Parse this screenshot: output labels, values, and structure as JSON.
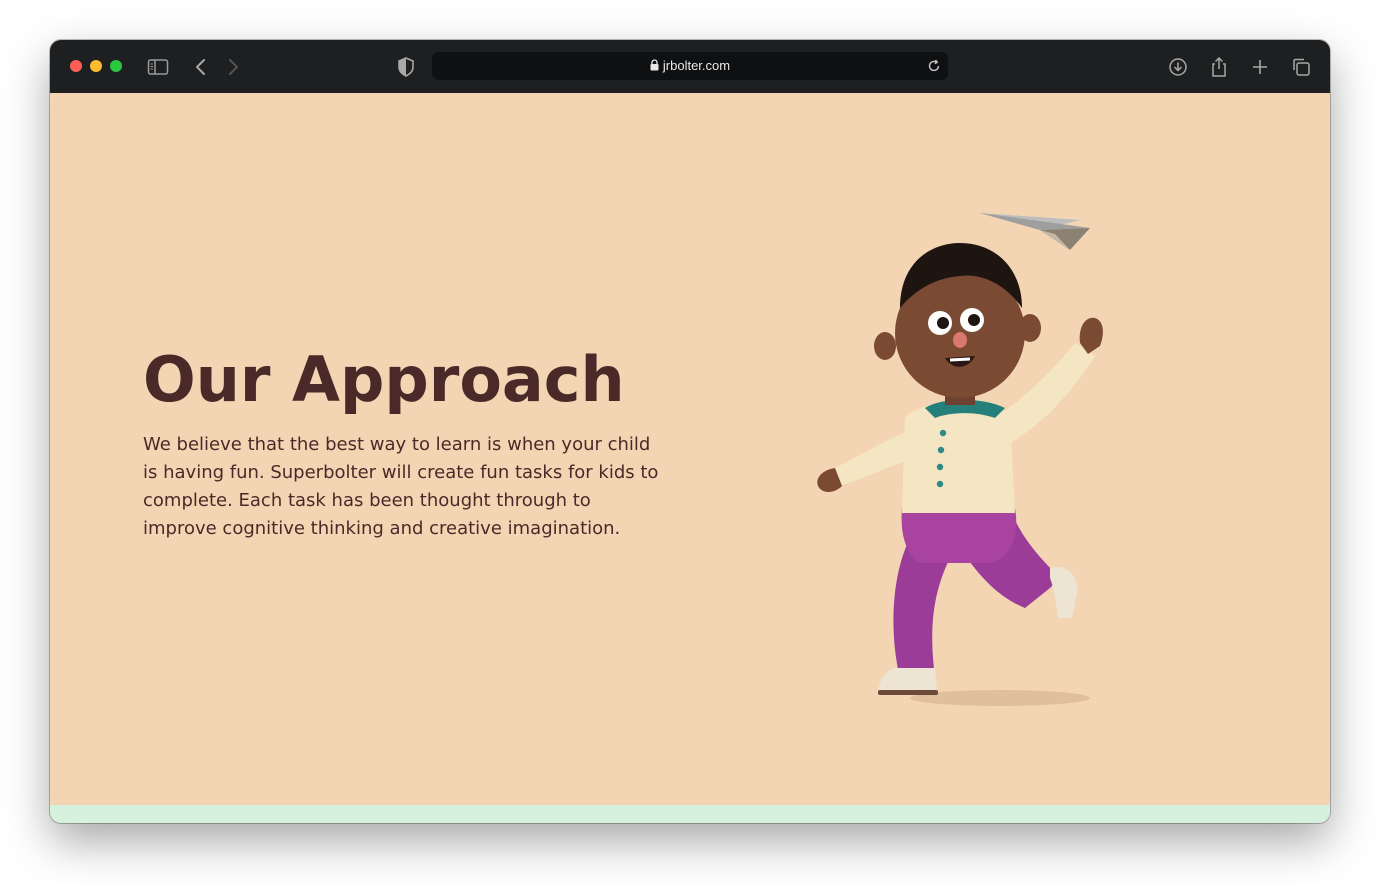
{
  "browser": {
    "url": "jrbolter.com",
    "icons": [
      "sidebar-icon",
      "back-icon",
      "forward-icon",
      "shield-icon",
      "lock-icon",
      "reload-icon",
      "download-icon",
      "share-icon",
      "plus-icon",
      "tabs-icon"
    ]
  },
  "section": {
    "heading": "Our Approach",
    "body": "We believe that the best way to learn is when your child is having fun. Superbolter will create fun tasks for kids to complete. Each task has been thought through to improve cognitive thinking and creative imagination."
  },
  "colors": {
    "page_bg": "#f3d5b4",
    "heading": "#4a2a28",
    "footer_strip": "#d6f1de",
    "toolbar": "#1d1f21"
  }
}
